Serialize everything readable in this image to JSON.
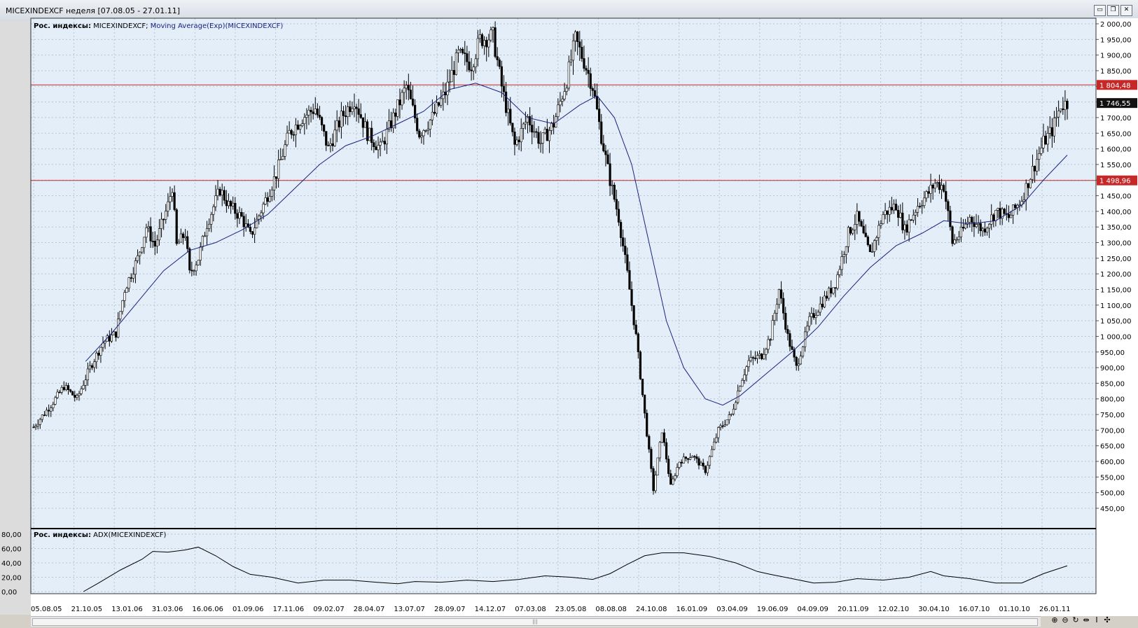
{
  "window": {
    "title": "MICEXINDEXCF  неделя [07.08.05 - 27.01.11]",
    "buttons": [
      "▭",
      "❐",
      "✕"
    ]
  },
  "panel_main": {
    "prefix": "Рос. индексы:",
    "series": "MICEXINDEXCF;",
    "indicator": "Moving Average(Exp)(MICEXINDEXCF)"
  },
  "panel_adx": {
    "prefix": "Рос. индексы:",
    "indicator": "ADX(MICEXINDEXCF)"
  },
  "nav_icons": [
    "zoom-in-icon",
    "zoom-out-icon",
    "reset-icon",
    "fit-icon",
    "cursor-icon",
    "scroll-icon"
  ],
  "chart_data": [
    {
      "type": "candlestick",
      "series_name": "MICEXINDEXCF",
      "ylim": [
        450,
        2000
      ],
      "y_ticks": [
        "2 000,00",
        "1 950,00",
        "1 900,00",
        "1 850,00",
        "1 800,00",
        "1 750,00",
        "1 700,00",
        "1 650,00",
        "1 600,00",
        "1 550,00",
        "1 500,00",
        "1 450,00",
        "1 400,00",
        "1 350,00",
        "1 300,00",
        "1 250,00",
        "1 200,00",
        "1 150,00",
        "1 100,00",
        "1 050,00",
        "1 000,00",
        "950,00",
        "900,00",
        "850,00",
        "800,00",
        "750,00",
        "700,00",
        "650,00",
        "600,00",
        "550,00",
        "500,00",
        "450,00"
      ],
      "x_ticks": [
        "05.08.05",
        "21.10.05",
        "13.01.06",
        "31.03.06",
        "16.06.06",
        "01.09.06",
        "17.11.06",
        "09.02.07",
        "28.04.07",
        "13.07.07",
        "28.09.07",
        "14.12.07",
        "07.03.08",
        "23.05.08",
        "08.08.08",
        "24.10.08",
        "16.01.09",
        "03.04.09",
        "19.06.09",
        "04.09.09",
        "20.11.09",
        "12.02.10",
        "30.04.10",
        "16.07.10",
        "01.10.10",
        "26.01.11"
      ],
      "hlines": [
        {
          "value": 1804.48,
          "label": "1 804,48",
          "color": "#c62828"
        },
        {
          "value": 1498.96,
          "label": "1 498,96",
          "color": "#c62828"
        }
      ],
      "last_price": {
        "value": 1746.55,
        "label": "1 746,55"
      },
      "close_path": [
        [
          0,
          710
        ],
        [
          8,
          780
        ],
        [
          14,
          840
        ],
        [
          20,
          800
        ],
        [
          26,
          900
        ],
        [
          32,
          980
        ],
        [
          38,
          1010
        ],
        [
          42,
          1150
        ],
        [
          48,
          1250
        ],
        [
          52,
          1350
        ],
        [
          56,
          1290
        ],
        [
          62,
          1420
        ],
        [
          64,
          1480
        ],
        [
          66,
          1290
        ],
        [
          70,
          1330
        ],
        [
          72,
          1200
        ],
        [
          76,
          1250
        ],
        [
          80,
          1360
        ],
        [
          86,
          1470
        ],
        [
          90,
          1420
        ],
        [
          96,
          1380
        ],
        [
          100,
          1320
        ],
        [
          106,
          1420
        ],
        [
          112,
          1520
        ],
        [
          118,
          1650
        ],
        [
          124,
          1700
        ],
        [
          130,
          1730
        ],
        [
          136,
          1600
        ],
        [
          142,
          1700
        ],
        [
          148,
          1760
        ],
        [
          154,
          1650
        ],
        [
          160,
          1600
        ],
        [
          166,
          1700
        ],
        [
          172,
          1800
        ],
        [
          178,
          1650
        ],
        [
          184,
          1700
        ],
        [
          190,
          1780
        ],
        [
          196,
          1900
        ],
        [
          202,
          1870
        ],
        [
          206,
          1950
        ],
        [
          212,
          1960
        ],
        [
          216,
          1800
        ],
        [
          222,
          1610
        ],
        [
          228,
          1700
        ],
        [
          234,
          1620
        ],
        [
          240,
          1680
        ],
        [
          246,
          1820
        ],
        [
          250,
          1950
        ],
        [
          254,
          1880
        ],
        [
          258,
          1800
        ],
        [
          262,
          1640
        ],
        [
          266,
          1500
        ],
        [
          270,
          1380
        ],
        [
          274,
          1200
        ],
        [
          278,
          1000
        ],
        [
          282,
          750
        ],
        [
          286,
          510
        ],
        [
          290,
          700
        ],
        [
          294,
          520
        ],
        [
          298,
          600
        ],
        [
          304,
          620
        ],
        [
          310,
          570
        ],
        [
          316,
          700
        ],
        [
          322,
          750
        ],
        [
          326,
          850
        ],
        [
          330,
          920
        ],
        [
          336,
          940
        ],
        [
          340,
          1000
        ],
        [
          344,
          1150
        ],
        [
          348,
          1000
        ],
        [
          352,
          900
        ],
        [
          358,
          1050
        ],
        [
          364,
          1110
        ],
        [
          370,
          1170
        ],
        [
          376,
          1330
        ],
        [
          380,
          1380
        ],
        [
          386,
          1260
        ],
        [
          392,
          1390
        ],
        [
          398,
          1420
        ],
        [
          402,
          1340
        ],
        [
          408,
          1420
        ],
        [
          412,
          1450
        ],
        [
          416,
          1490
        ],
        [
          420,
          1480
        ],
        [
          424,
          1300
        ],
        [
          428,
          1330
        ],
        [
          432,
          1380
        ],
        [
          438,
          1340
        ],
        [
          444,
          1400
        ],
        [
          450,
          1380
        ],
        [
          456,
          1440
        ],
        [
          462,
          1550
        ],
        [
          466,
          1620
        ],
        [
          470,
          1660
        ],
        [
          474,
          1740
        ],
        [
          477,
          1746.55
        ]
      ],
      "ema_path": [
        [
          24,
          920
        ],
        [
          36,
          1010
        ],
        [
          48,
          1110
        ],
        [
          60,
          1210
        ],
        [
          72,
          1275
        ],
        [
          84,
          1300
        ],
        [
          96,
          1340
        ],
        [
          108,
          1390
        ],
        [
          120,
          1470
        ],
        [
          132,
          1550
        ],
        [
          144,
          1610
        ],
        [
          156,
          1640
        ],
        [
          168,
          1680
        ],
        [
          180,
          1720
        ],
        [
          192,
          1790
        ],
        [
          204,
          1810
        ],
        [
          216,
          1780
        ],
        [
          228,
          1700
        ],
        [
          240,
          1680
        ],
        [
          252,
          1740
        ],
        [
          260,
          1770
        ],
        [
          268,
          1700
        ],
        [
          276,
          1550
        ],
        [
          284,
          1300
        ],
        [
          292,
          1050
        ],
        [
          300,
          900
        ],
        [
          310,
          800
        ],
        [
          318,
          780
        ],
        [
          326,
          810
        ],
        [
          338,
          880
        ],
        [
          350,
          950
        ],
        [
          362,
          1030
        ],
        [
          374,
          1130
        ],
        [
          386,
          1220
        ],
        [
          398,
          1290
        ],
        [
          410,
          1330
        ],
        [
          420,
          1370
        ],
        [
          432,
          1360
        ],
        [
          444,
          1370
        ],
        [
          456,
          1420
        ],
        [
          466,
          1500
        ],
        [
          477,
          1580
        ]
      ],
      "x_range": [
        0,
        477
      ]
    },
    {
      "type": "line",
      "series_name": "ADX(MICEXINDEXCF)",
      "ylim": [
        0,
        80
      ],
      "y_ticks": [
        "80,00",
        "60,00",
        "40,00",
        "20,00",
        "0,00"
      ],
      "values": [
        [
          23,
          0
        ],
        [
          30,
          12
        ],
        [
          40,
          30
        ],
        [
          50,
          45
        ],
        [
          55,
          56
        ],
        [
          62,
          55
        ],
        [
          70,
          58
        ],
        [
          76,
          62
        ],
        [
          84,
          50
        ],
        [
          92,
          35
        ],
        [
          100,
          24
        ],
        [
          110,
          20
        ],
        [
          122,
          12
        ],
        [
          134,
          16
        ],
        [
          146,
          16
        ],
        [
          158,
          13
        ],
        [
          168,
          11
        ],
        [
          176,
          14
        ],
        [
          188,
          13
        ],
        [
          200,
          16
        ],
        [
          212,
          14
        ],
        [
          224,
          17
        ],
        [
          236,
          22
        ],
        [
          248,
          20
        ],
        [
          258,
          17
        ],
        [
          266,
          25
        ],
        [
          274,
          38
        ],
        [
          282,
          50
        ],
        [
          290,
          54
        ],
        [
          300,
          54
        ],
        [
          312,
          49
        ],
        [
          324,
          40
        ],
        [
          334,
          28
        ],
        [
          340,
          24
        ],
        [
          350,
          18
        ],
        [
          360,
          12
        ],
        [
          370,
          13
        ],
        [
          380,
          18
        ],
        [
          392,
          16
        ],
        [
          404,
          20
        ],
        [
          414,
          28
        ],
        [
          420,
          22
        ],
        [
          432,
          18
        ],
        [
          444,
          12
        ],
        [
          456,
          12
        ],
        [
          466,
          25
        ],
        [
          477,
          36
        ]
      ]
    }
  ]
}
